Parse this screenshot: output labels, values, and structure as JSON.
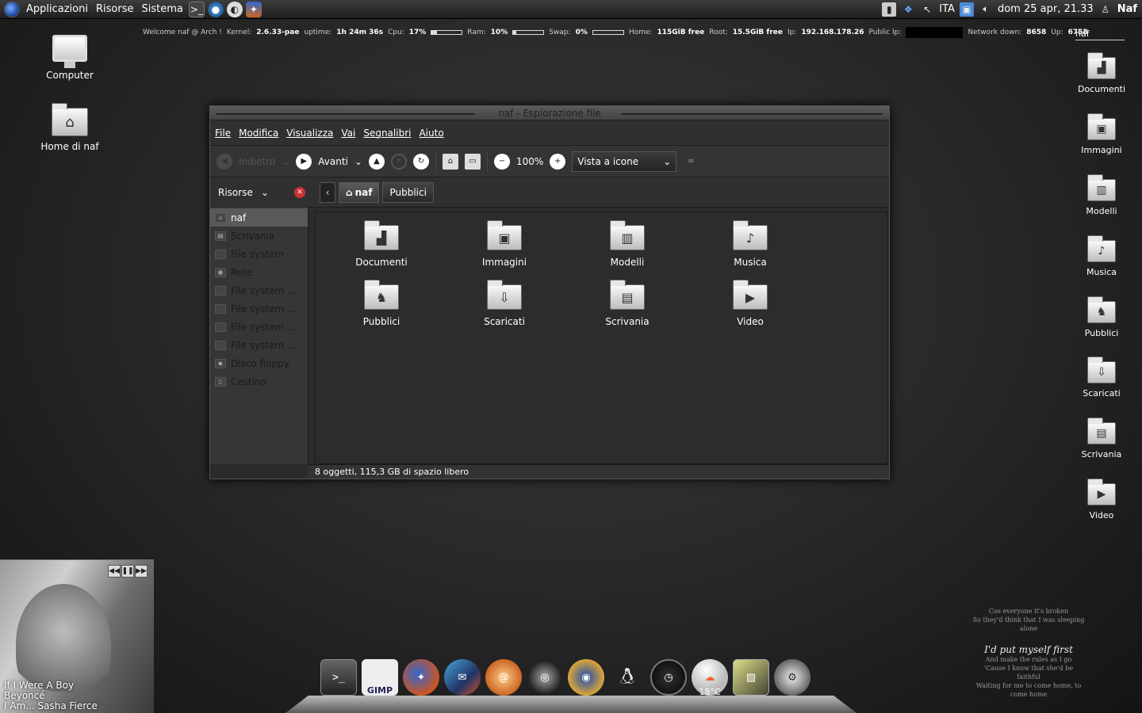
{
  "top_panel": {
    "menus": [
      "Applicazioni",
      "Risorse",
      "Sistema"
    ],
    "launchers": [
      "terminal-icon",
      "chromium-icon",
      "pidgin-icon",
      "firefox-icon"
    ],
    "tray": {
      "keyboard_layout": "ITA",
      "datetime": "dom 25 apr, 21.33",
      "user": "Naf"
    }
  },
  "conky": {
    "welcome": "Welcome naf @ Arch !",
    "kernel_label": "Kernel:",
    "kernel": "2.6.33-pae",
    "uptime_label": "uptime:",
    "uptime": "1h 24m 36s",
    "cpu_label": "Cpu:",
    "cpu": "17%",
    "cpu_fraction": 0.17,
    "ram_label": "Ram:",
    "ram": "10%",
    "ram_fraction": 0.1,
    "swap_label": "Swap:",
    "swap": "0%",
    "swap_fraction": 0.0,
    "home_label": "Home:",
    "home": "115GiB free",
    "root_label": "Root:",
    "root": "15.5GiB free",
    "ip_label": "Ip:",
    "ip": "192.168.178.26",
    "public_ip_label": "Public Ip:",
    "network_down_label": "Network down:",
    "network_down": "8658",
    "up_label": "Up:",
    "up": "6758"
  },
  "desktop_icons": [
    {
      "label": "Computer",
      "icon": "computer-icon"
    },
    {
      "label": "Home di naf",
      "icon": "home-folder-icon"
    }
  ],
  "right_column": {
    "title": "naf",
    "items": [
      "Documenti",
      "Immagini",
      "Modelli",
      "Musica",
      "Pubblici",
      "Scaricati",
      "Scrivania",
      "Video"
    ]
  },
  "file_manager": {
    "title": "naf - Esplorazione file",
    "menu": [
      "File",
      "Modifica",
      "Visualizza",
      "Vai",
      "Segnalibri",
      "Aiuto"
    ],
    "toolbar": {
      "back": "Indietro",
      "forward": "Avanti",
      "zoom": "100%",
      "view_mode": "Vista a icone"
    },
    "side_pane_title": "Risorse",
    "breadcrumbs": [
      "naf",
      "Pubblici"
    ],
    "sidebar": [
      "naf",
      "Scrivania",
      "File system",
      "Rete",
      "File system ...",
      "File system ...",
      "File system ...",
      "File system ...",
      "Disco floppy",
      "Cestino"
    ],
    "items": [
      {
        "label": "Documenti",
        "icon": "documents-folder-icon"
      },
      {
        "label": "Immagini",
        "icon": "pictures-folder-icon"
      },
      {
        "label": "Modelli",
        "icon": "templates-folder-icon"
      },
      {
        "label": "Musica",
        "icon": "music-folder-icon"
      },
      {
        "label": "Pubblici",
        "icon": "public-folder-icon"
      },
      {
        "label": "Scaricati",
        "icon": "downloads-folder-icon"
      },
      {
        "label": "Scrivania",
        "icon": "desktop-folder-icon"
      },
      {
        "label": "Video",
        "icon": "videos-folder-icon"
      }
    ],
    "status": "8 oggetti, 115,3 GB di spazio libero"
  },
  "music_player": {
    "title": "If I Were A Boy",
    "artist": "Beyoncé",
    "album": "I Am... Sasha Fierce"
  },
  "lyrics": {
    "small_1": "Cos everyone it's broken",
    "small_2": "So they'd think that I was sleeping alone",
    "big": "I'd put myself first",
    "small_3": "And make the rules as I go",
    "small_4": "'Cause I know that she'd be faithful",
    "small_5": "Waiting for me to come home, to come home"
  },
  "dock": {
    "items": [
      "terminal-icon",
      "gimp-icon",
      "firefox-icon",
      "thunderbird-icon",
      "nautilus-icon",
      "media-icon",
      "chromium-icon",
      "tux-icon",
      "clock-icon",
      "weather-icon",
      "photo-icon",
      "settings-icon"
    ],
    "gimp_label": "GIMP",
    "temperature": "18°C"
  },
  "colors": {
    "panel": "#2a2a2a",
    "accent": "#595959",
    "dock_gloss": "#bbbbbb"
  }
}
